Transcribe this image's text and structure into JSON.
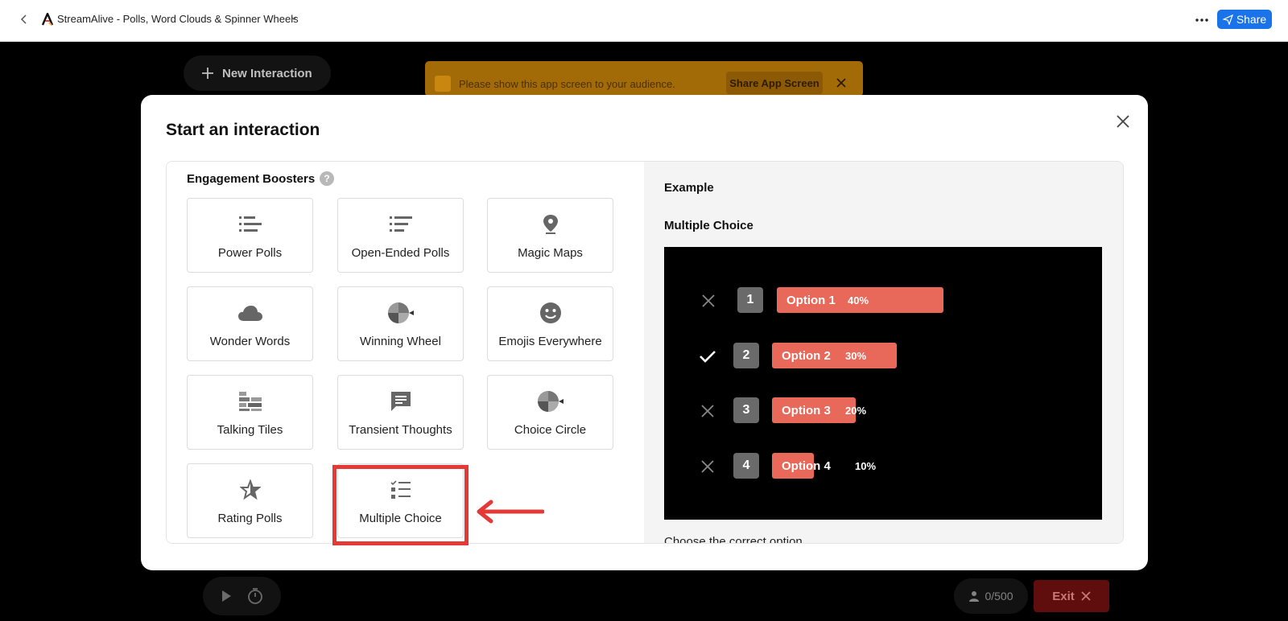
{
  "topbar": {
    "title": "StreamAlive - Polls, Word Clouds & Spinner Wheels",
    "share_label": "Share",
    "more_icon": "ellipsis-icon",
    "back_icon": "chevron-left-icon"
  },
  "backdrop": {
    "new_interaction_label": "New Interaction",
    "notice_text": "Please show this app screen to your audience.",
    "notice_button": "Share App Screen",
    "participants": "0/500",
    "exit_label": "Exit"
  },
  "modal": {
    "title": "Start an interaction",
    "section_title": "Engagement Boosters",
    "help_icon_text": "?",
    "tiles": [
      {
        "label": "Power Polls",
        "icon": "bar-list-icon"
      },
      {
        "label": "Open-Ended Polls",
        "icon": "numbered-list-icon"
      },
      {
        "label": "Magic Maps",
        "icon": "map-pin-icon"
      },
      {
        "label": "Wonder Words",
        "icon": "cloud-icon"
      },
      {
        "label": "Winning Wheel",
        "icon": "spinner-wheel-icon"
      },
      {
        "label": "Emojis Everywhere",
        "icon": "smiley-icon"
      },
      {
        "label": "Talking Tiles",
        "icon": "tiles-icon"
      },
      {
        "label": "Transient Thoughts",
        "icon": "chat-bubble-icon"
      },
      {
        "label": "Choice Circle",
        "icon": "choice-wheel-icon"
      },
      {
        "label": "Rating Polls",
        "icon": "star-icon"
      },
      {
        "label": "Multiple Choice",
        "icon": "checklist-icon"
      }
    ],
    "selected_tile": "Multiple Choice",
    "example": {
      "label": "Example",
      "name": "Multiple Choice",
      "caption": "Choose the correct option",
      "options": [
        {
          "num": "1",
          "label": "Option 1",
          "pct": "40%",
          "fraction": 0.4,
          "correct": false
        },
        {
          "num": "2",
          "label": "Option 2",
          "pct": "30%",
          "fraction": 0.3,
          "correct": true
        },
        {
          "num": "3",
          "label": "Option 3",
          "pct": "20%",
          "fraction": 0.2,
          "correct": false
        },
        {
          "num": "4",
          "label": "Option 4",
          "pct": "10%",
          "fraction": 0.1,
          "correct": false
        }
      ]
    }
  },
  "colors": {
    "accent_blue": "#1a73e8",
    "bar": "#e8685a",
    "highlight": "#e53935",
    "exit": "#5f0d0d"
  }
}
